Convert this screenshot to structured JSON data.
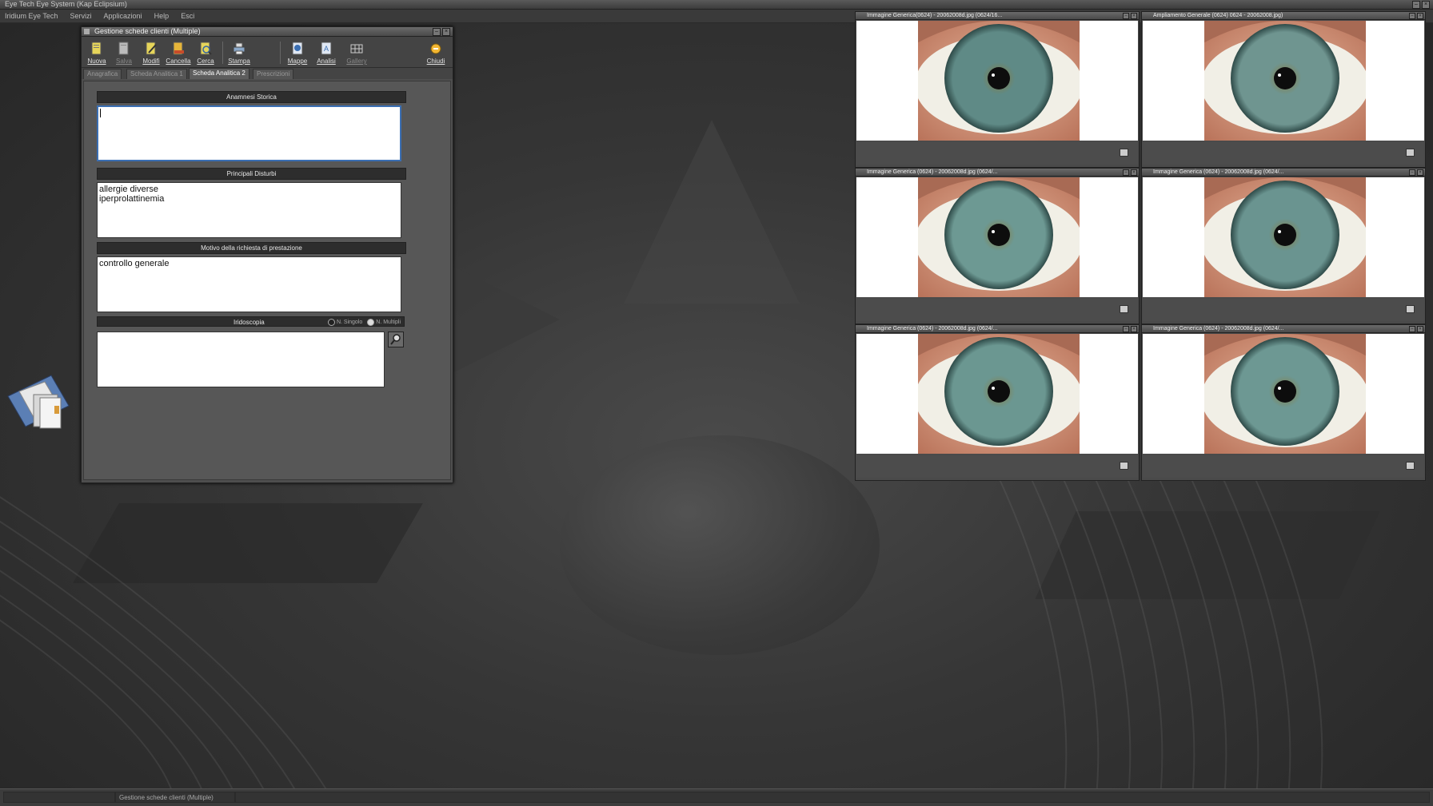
{
  "app": {
    "window_title": "Eye Tech Eye System (Kap Eclipsium)",
    "menu": [
      "Iridium Eye Tech",
      "Servizi",
      "Applicazioni",
      "Help",
      "Esci"
    ]
  },
  "main_window": {
    "title": "Gestione schede clienti (Multiple)",
    "toolbar": [
      {
        "label": "Nuova",
        "icon": "new-doc-icon",
        "enabled": true
      },
      {
        "label": "Salva",
        "icon": "save-doc-icon",
        "enabled": false
      },
      {
        "label": "Modifi",
        "icon": "edit-doc-icon",
        "enabled": true
      },
      {
        "label": "Cancella",
        "icon": "delete-doc-icon",
        "enabled": true
      },
      {
        "label": "Cerca",
        "icon": "search-doc-icon",
        "enabled": true
      },
      {
        "label": "Stampa",
        "icon": "print-icon",
        "enabled": true
      },
      {
        "label": "Mappe",
        "icon": "map-icon",
        "enabled": true
      },
      {
        "label": "Analisi",
        "icon": "analysis-icon",
        "enabled": true
      },
      {
        "label": "Gallery",
        "icon": "gallery-icon",
        "enabled": false
      },
      {
        "label": "Chiudi",
        "icon": "close-door-icon",
        "enabled": true
      }
    ],
    "tabs": [
      {
        "label": "Anagrafica",
        "active": false
      },
      {
        "label": "Scheda Analitica 1",
        "active": false
      },
      {
        "label": "Scheda Analitica 2",
        "active": true
      },
      {
        "label": "Prescrizioni",
        "active": false
      }
    ],
    "sections": {
      "anamnesi": {
        "title": "Anamnesi Storica",
        "value": ""
      },
      "disturbi": {
        "title": "Principali Disturbi",
        "value": "allergie diverse\niperprolattinemia"
      },
      "motivo": {
        "title": "Motivo della richiesta di prestazione",
        "value": "controllo generale"
      },
      "iridoscopia": {
        "title": "Iridoscopia",
        "value": "",
        "options": [
          {
            "label": "N. Singolo",
            "selected": false
          },
          {
            "label": "N. Multipli",
            "selected": true
          }
        ]
      }
    }
  },
  "image_panels": [
    {
      "title": "Immagine Generica(0624) - 20062008d.jpg (0624/16...",
      "iris_color": "#5f8a86"
    },
    {
      "title": "Ampliamento Generale (0624) 0624 - 20062008.jpg)",
      "iris_color": "#6f9590"
    },
    {
      "title": "Immagine Generica (0624) - 20062008d.jpg (0624/...",
      "iris_color": "#6d9993"
    },
    {
      "title": "Immagine Generica (0624) - 20062008d.jpg (0624/...",
      "iris_color": "#6a9490"
    },
    {
      "title": "Immagine Generica (0624) - 20062008d.jpg (0624/...",
      "iris_color": "#6b9791"
    },
    {
      "title": "Immagine Generica (0624) - 20062008d.jpg (0624/...",
      "iris_color": "#6d9893"
    }
  ],
  "status_bar": {
    "text": "Gestione schede clienti (Multiple)"
  },
  "colors": {
    "focus_border": "#3b6fb3",
    "section_header_bg": "#2d2d2d",
    "window_bg": "#4e4e4e"
  }
}
